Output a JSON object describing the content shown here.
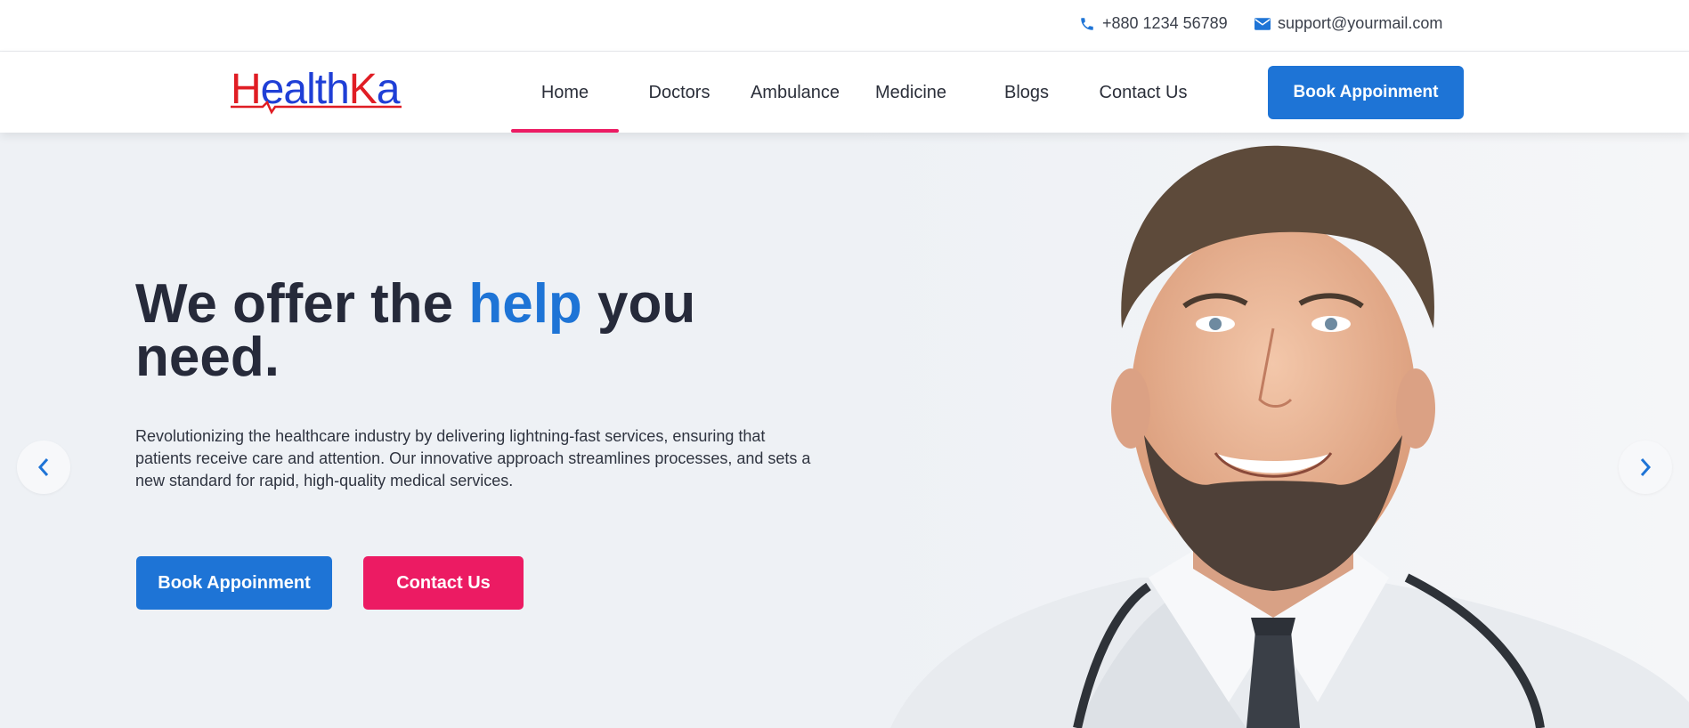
{
  "topbar": {
    "phone": "+880 1234 56789",
    "email": "support@yourmail.com"
  },
  "brand": {
    "logo_part1": "H",
    "logo_part2": "ealth",
    "logo_part3": "K",
    "logo_part4": "a"
  },
  "nav": {
    "items": [
      {
        "label": "Home",
        "active": true
      },
      {
        "label": "Doctors",
        "active": false
      },
      {
        "label": "Ambulance",
        "active": false
      },
      {
        "label": "Medicine",
        "active": false
      },
      {
        "label": "Blogs",
        "active": false
      },
      {
        "label": "Contact Us",
        "active": false
      }
    ],
    "cta_label": "Book Appoinment"
  },
  "hero": {
    "headline_part1": "We offer the",
    "headline_accent": "help",
    "headline_part2": "you need.",
    "description": "Revolutionizing the healthcare industry by delivering lightning-fast services, ensuring that patients receive care and attention. Our innovative approach streamlines processes, and sets a new standard for rapid, high-quality medical services.",
    "primary_button": "Book Appoinment",
    "secondary_button": "Contact Us"
  },
  "colors": {
    "primary": "#1e74d6",
    "accent": "#ec1b63",
    "logo_red": "#e01d24",
    "logo_blue": "#1f3fd6",
    "hero_bg": "#eef1f5"
  },
  "icons": {
    "phone": "phone-icon",
    "email": "envelope-icon",
    "prev": "chevron-left-icon",
    "next": "chevron-right-icon"
  }
}
